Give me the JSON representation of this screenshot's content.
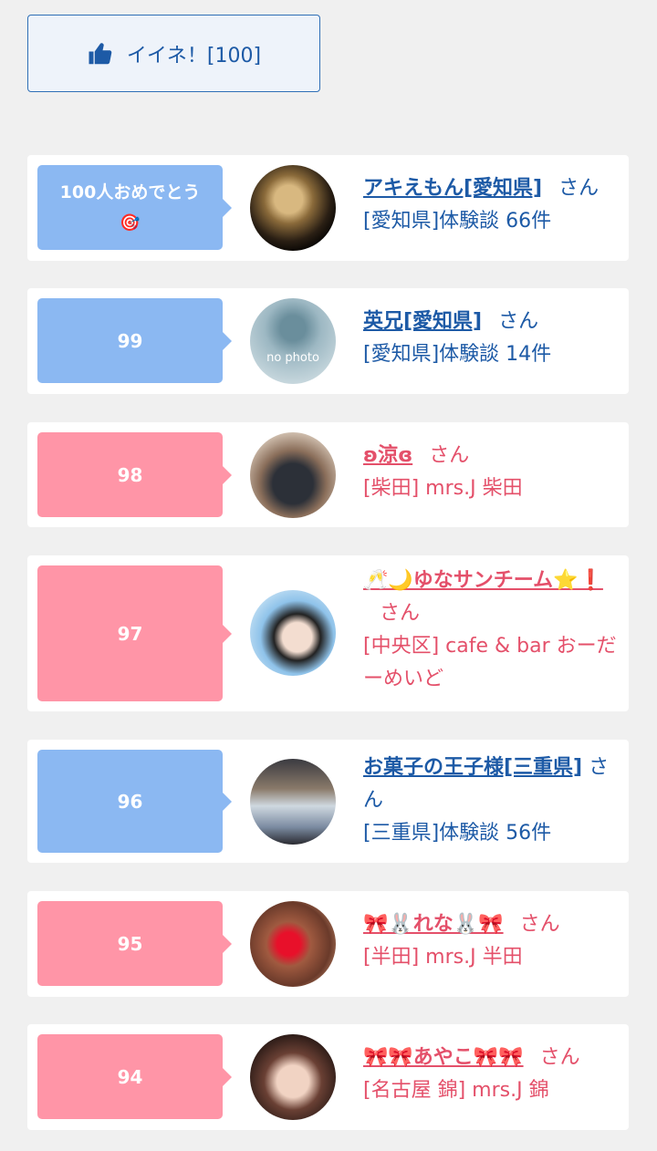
{
  "like_button": {
    "label": "イイネ！[100]"
  },
  "entries": [
    {
      "badge": "100人おめでとう",
      "badge_emoji": "🎯",
      "name": "アキえもん[愛知県]",
      "san": "さん",
      "sub": "[愛知県]体験談 66件",
      "theme": "blue"
    },
    {
      "badge": "99",
      "name": "英兄[愛知県]",
      "san": "さん",
      "sub": "[愛知県]体験談 14件",
      "theme": "blue",
      "avatar_text": "no photo"
    },
    {
      "badge": "98",
      "name": "ʚ涼ɞ",
      "san": "さん",
      "sub": "[柴田] mrs.J 柴田",
      "theme": "pink"
    },
    {
      "badge": "97",
      "name": "🥂🌙ゆなサンチーム⭐❗",
      "san": "さん",
      "sub": "[中央区] cafe & bar おーだーめいど",
      "theme": "pink"
    },
    {
      "badge": "96",
      "name": "お菓子の王子様[三重県]",
      "san": "さん",
      "sub": "[三重県]体験談 56件",
      "theme": "blue"
    },
    {
      "badge": "95",
      "name": "🎀🐰れな🐰🎀",
      "san": "さん",
      "sub": "[半田] mrs.J 半田",
      "theme": "pink"
    },
    {
      "badge": "94",
      "name": "🎀🎀あやこ🎀🎀",
      "san": "さん",
      "sub": "[名古屋 錦] mrs.J 錦",
      "theme": "pink"
    }
  ]
}
